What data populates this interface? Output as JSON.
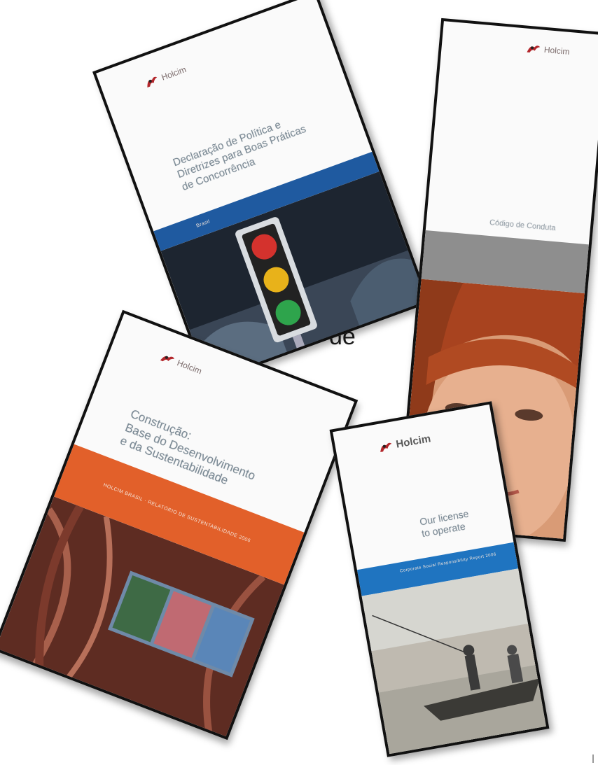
{
  "slide": {
    "partial_text": "de"
  },
  "brochures": [
    {
      "id": "concorrencia",
      "logo": "Holcim",
      "title_lines": [
        "Declaração de Política e",
        "Diretrizes para Boas Práticas",
        "de Concorrência"
      ],
      "band_color": "#1f5aa0",
      "band_text": "Brasil",
      "photo": "traffic-light"
    },
    {
      "id": "codigo",
      "logo": "Holcim",
      "title_lines": [
        "Código de Conduta"
      ],
      "band_color": "#8e8e8e",
      "band_text": "",
      "photo": "woman-face"
    },
    {
      "id": "construcao",
      "logo": "Holcim",
      "title_lines": [
        "Construção:",
        "Base do Desenvolvimento",
        "e da Sustentabilidade"
      ],
      "band_color": "#e2602a",
      "band_text": "HOLCIM BRASIL · RELATÓRIO DE SUSTENTABILIDADE 2006",
      "photo": "red-fabric"
    },
    {
      "id": "license",
      "logo": "Holcim",
      "title_lines": [
        "Our license",
        "to operate"
      ],
      "band_color": "#1f74c0",
      "band_text": "Corporate Social Responsibility Report 2006",
      "photo": "fisherman-boat"
    }
  ],
  "colors": {
    "holcim_red": "#b3262b",
    "border": "#111111"
  },
  "icons": {
    "logo": "holcim-logo-icon"
  }
}
